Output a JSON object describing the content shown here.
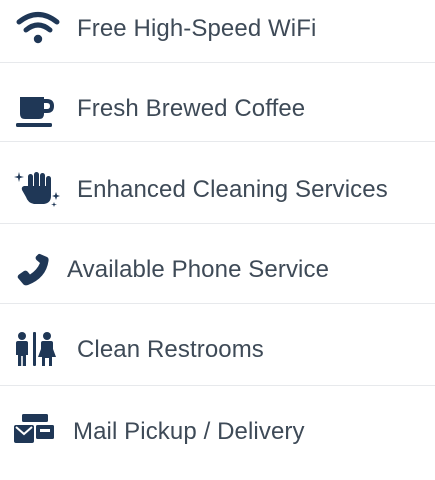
{
  "colors": {
    "icon": "#1f3756",
    "text": "#3e4a57",
    "divider": "#e7e9ec",
    "background": "#ffffff"
  },
  "amenities": [
    {
      "icon": "wifi-icon",
      "label": "Free High-Speed WiFi"
    },
    {
      "icon": "coffee-mug-icon",
      "label": "Fresh Brewed Coffee"
    },
    {
      "icon": "hand-sparkles-icon",
      "label": "Enhanced Cleaning Services"
    },
    {
      "icon": "phone-icon",
      "label": "Available Phone Service"
    },
    {
      "icon": "restroom-icon",
      "label": "Clean Restrooms"
    },
    {
      "icon": "mail-delivery-icon",
      "label": "Mail Pickup / Delivery"
    }
  ]
}
